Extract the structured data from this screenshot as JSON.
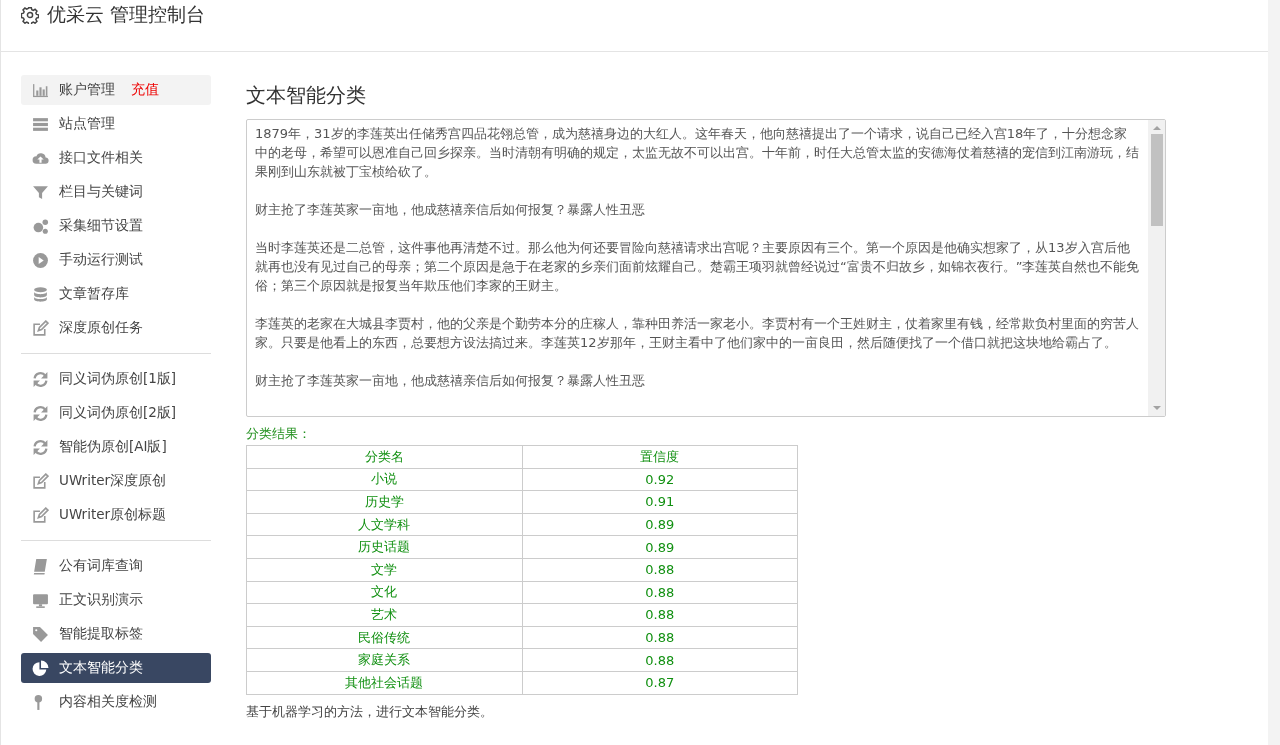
{
  "header": {
    "title": "优采云 管理控制台"
  },
  "sidebar": {
    "groups": [
      {
        "items": [
          {
            "label": "账户管理",
            "badge": "充值",
            "hovered": true,
            "selected": false
          },
          {
            "label": "站点管理",
            "hovered": false,
            "selected": false
          },
          {
            "label": "接口文件相关",
            "hovered": false,
            "selected": false
          },
          {
            "label": "栏目与关键词",
            "hovered": false,
            "selected": false
          },
          {
            "label": "采集细节设置",
            "hovered": false,
            "selected": false
          },
          {
            "label": "手动运行测试",
            "hovered": false,
            "selected": false
          },
          {
            "label": "文章暂存库",
            "hovered": false,
            "selected": false
          },
          {
            "label": "深度原创任务",
            "hovered": false,
            "selected": false
          }
        ]
      },
      {
        "items": [
          {
            "label": "同义词伪原创[1版]",
            "hovered": false,
            "selected": false
          },
          {
            "label": "同义词伪原创[2版]",
            "hovered": false,
            "selected": false
          },
          {
            "label": "智能伪原创[AI版]",
            "hovered": false,
            "selected": false
          },
          {
            "label": "UWriter深度原创",
            "hovered": false,
            "selected": false
          },
          {
            "label": "UWriter原创标题",
            "hovered": false,
            "selected": false
          }
        ]
      },
      {
        "items": [
          {
            "label": "公有词库查询",
            "hovered": false,
            "selected": false
          },
          {
            "label": "正文识别演示",
            "hovered": false,
            "selected": false
          },
          {
            "label": "智能提取标签",
            "hovered": false,
            "selected": false
          },
          {
            "label": "文本智能分类",
            "hovered": false,
            "selected": true
          },
          {
            "label": "内容相关度检测",
            "hovered": false,
            "selected": false
          }
        ]
      }
    ]
  },
  "content": {
    "title": "文本智能分类",
    "text_area": {
      "paragraphs": [
        "1879年，31岁的李莲英出任储秀宫四品花翎总管，成为慈禧身边的大红人。这年春天，他向慈禧提出了一个请求，说自己已经入宫18年了，十分想念家中的老母，希望可以恩准自己回乡探亲。当时清朝有明确的规定，太监无故不可以出宫。十年前，时任大总管太监的安德海仗着慈禧的宠信到江南游玩，结果刚到山东就被丁宝桢给砍了。",
        "财主抢了李莲英家一亩地，他成慈禧亲信后如何报复？暴露人性丑恶",
        "当时李莲英还是二总管，这件事他再清楚不过。那么他为何还要冒险向慈禧请求出宫呢？主要原因有三个。第一个原因是他确实想家了，从13岁入宫后他就再也没有见过自己的母亲；第二个原因是急于在老家的乡亲们面前炫耀自己。楚霸王项羽就曾经说过“富贵不归故乡，如锦衣夜行。”李莲英自然也不能免俗；第三个原因就是报复当年欺压他们李家的王财主。",
        "李莲英的老家在大城县李贾村，他的父亲是个勤劳本分的庄稼人，靠种田养活一家老小。李贾村有一个王姓财主，仗着家里有钱，经常欺负村里面的穷苦人家。只要是他看上的东西，总要想方设法搞过来。李莲英12岁那年，王财主看中了他们家中的一亩良田，然后随便找了一个借口就把这块地给霸占了。",
        "财主抢了李莲英家一亩地，他成慈禧亲信后如何报复？暴露人性丑恶"
      ]
    },
    "result_label": "分类结果：",
    "table": {
      "columns": [
        "分类名",
        "置信度"
      ],
      "rows": [
        [
          "小说",
          "0.92"
        ],
        [
          "历史学",
          "0.91"
        ],
        [
          "人文学科",
          "0.89"
        ],
        [
          "历史话题",
          "0.89"
        ],
        [
          "文学",
          "0.88"
        ],
        [
          "文化",
          "0.88"
        ],
        [
          "艺术",
          "0.88"
        ],
        [
          "民俗传统",
          "0.88"
        ],
        [
          "家庭关系",
          "0.88"
        ],
        [
          "其他社会话题",
          "0.87"
        ]
      ]
    },
    "note": "基于机器学习的方法，进行文本智能分类。"
  }
}
